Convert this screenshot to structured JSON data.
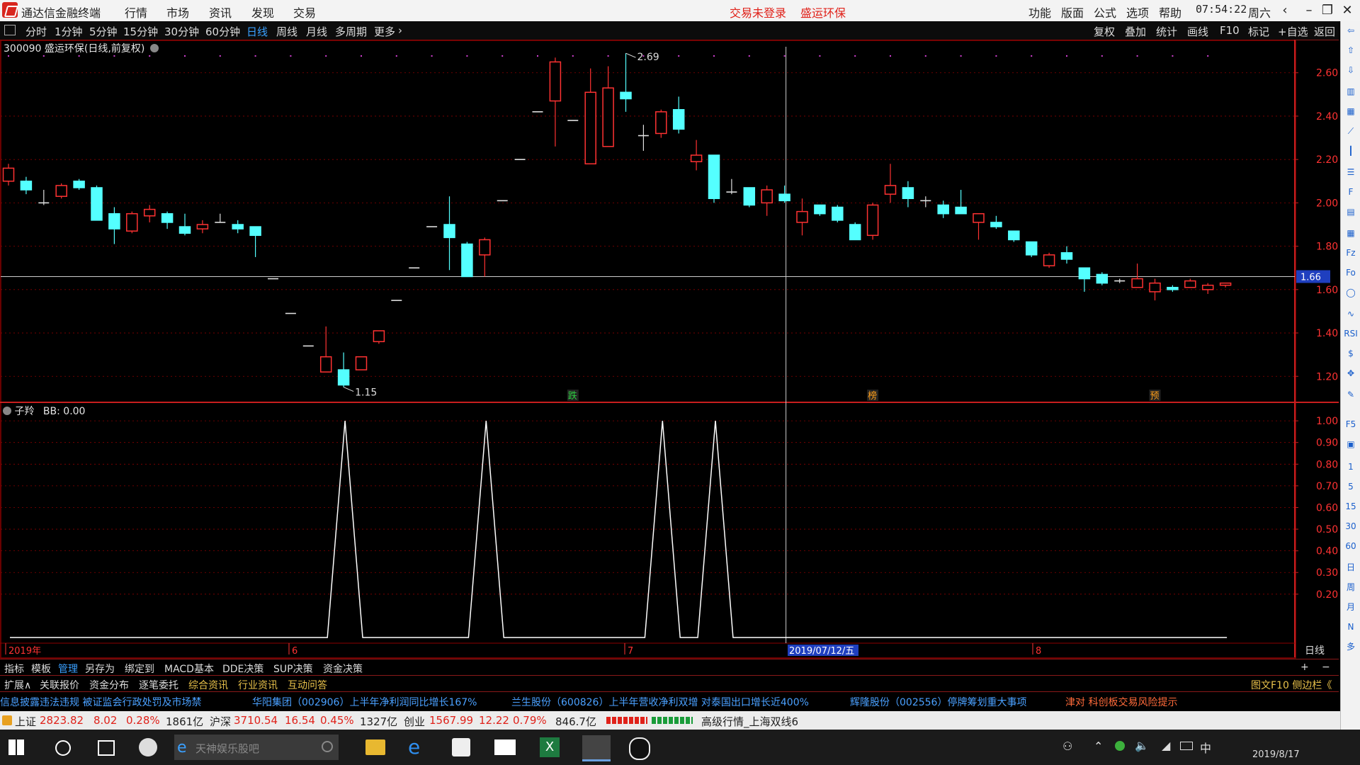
{
  "titlebar": {
    "app_name": "通达信金融终端",
    "menus": [
      "行情",
      "市场",
      "资讯",
      "发现",
      "交易"
    ],
    "login_status": "交易未登录",
    "stock_name": "盛运环保",
    "right_menus": [
      "功能",
      "版面",
      "公式",
      "选项",
      "帮助"
    ],
    "time": "07:54:22",
    "weekday": "周六"
  },
  "toolbar": {
    "periods": [
      "分时",
      "1分钟",
      "5分钟",
      "15分钟",
      "30分钟",
      "60分钟",
      "日线",
      "周线",
      "月线",
      "多周期",
      "更多"
    ],
    "active_period": "日线",
    "right_tools": [
      "复权",
      "叠加",
      "统计",
      "画线",
      "F10",
      "标记",
      "+自选",
      "返回"
    ]
  },
  "chart_header": {
    "code": "300090",
    "title": "盛运环保(日线,前复权)"
  },
  "sub_header": {
    "indicator": "子羚",
    "value_label": "BB: 0.00"
  },
  "chart_data": [
    {
      "type": "candlestick",
      "title": "300090 盛运环保(日线,前复权)",
      "yticks": [
        2.6,
        2.4,
        2.2,
        2.0,
        1.8,
        1.6,
        1.4,
        1.2
      ],
      "ylim": [
        1.08,
        2.72
      ],
      "price_tag": "1.66",
      "high_annotation": "2.69",
      "low_annotation": "1.15",
      "candles": [
        {
          "o": 2.1,
          "h": 2.18,
          "l": 2.08,
          "c": 2.16
        },
        {
          "o": 2.1,
          "h": 2.12,
          "l": 2.04,
          "c": 2.06
        },
        {
          "o": 2.0,
          "h": 2.06,
          "l": 1.99,
          "c": 2.0
        },
        {
          "o": 2.03,
          "h": 2.09,
          "l": 2.02,
          "c": 2.08
        },
        {
          "o": 2.1,
          "h": 2.11,
          "l": 2.06,
          "c": 2.07
        },
        {
          "o": 2.07,
          "h": 2.08,
          "l": 1.93,
          "c": 1.92
        },
        {
          "o": 1.95,
          "h": 1.98,
          "l": 1.81,
          "c": 1.88
        },
        {
          "o": 1.87,
          "h": 1.96,
          "l": 1.86,
          "c": 1.95
        },
        {
          "o": 1.94,
          "h": 1.99,
          "l": 1.91,
          "c": 1.97
        },
        {
          "o": 1.95,
          "h": 1.96,
          "l": 1.88,
          "c": 1.91
        },
        {
          "o": 1.89,
          "h": 1.95,
          "l": 1.85,
          "c": 1.86
        },
        {
          "o": 1.88,
          "h": 1.92,
          "l": 1.86,
          "c": 1.9
        },
        {
          "o": 1.91,
          "h": 1.95,
          "l": 1.91,
          "c": 1.91
        },
        {
          "o": 1.9,
          "h": 1.92,
          "l": 1.86,
          "c": 1.88
        },
        {
          "o": 1.89,
          "h": 1.89,
          "l": 1.75,
          "c": 1.85
        },
        {
          "o": 1.65,
          "h": 1.65,
          "l": 1.65,
          "c": 1.65
        },
        {
          "o": 1.49,
          "h": 1.49,
          "l": 1.49,
          "c": 1.49
        },
        {
          "o": 1.34,
          "h": 1.34,
          "l": 1.34,
          "c": 1.34
        },
        {
          "o": 1.22,
          "h": 1.43,
          "l": 1.22,
          "c": 1.29
        },
        {
          "o": 1.23,
          "h": 1.31,
          "l": 1.15,
          "c": 1.16
        },
        {
          "o": 1.23,
          "h": 1.29,
          "l": 1.23,
          "c": 1.29
        },
        {
          "o": 1.36,
          "h": 1.41,
          "l": 1.35,
          "c": 1.41
        },
        {
          "o": 1.55,
          "h": 1.55,
          "l": 1.55,
          "c": 1.55
        },
        {
          "o": 1.7,
          "h": 1.7,
          "l": 1.7,
          "c": 1.7
        },
        {
          "o": 1.89,
          "h": 1.89,
          "l": 1.89,
          "c": 1.89
        },
        {
          "o": 1.9,
          "h": 2.03,
          "l": 1.69,
          "c": 1.84
        },
        {
          "o": 1.81,
          "h": 1.82,
          "l": 1.66,
          "c": 1.66
        },
        {
          "o": 1.76,
          "h": 1.84,
          "l": 1.66,
          "c": 1.83
        },
        {
          "o": 2.01,
          "h": 2.01,
          "l": 2.01,
          "c": 2.01
        },
        {
          "o": 2.2,
          "h": 2.2,
          "l": 2.2,
          "c": 2.2
        },
        {
          "o": 2.42,
          "h": 2.42,
          "l": 2.42,
          "c": 2.42
        },
        {
          "o": 2.47,
          "h": 2.67,
          "l": 2.26,
          "c": 2.65
        },
        {
          "o": 2.38,
          "h": 2.38,
          "l": 2.38,
          "c": 2.38
        },
        {
          "o": 2.18,
          "h": 2.62,
          "l": 2.18,
          "c": 2.51
        },
        {
          "o": 2.26,
          "h": 2.63,
          "l": 2.26,
          "c": 2.53
        },
        {
          "o": 2.51,
          "h": 2.69,
          "l": 2.42,
          "c": 2.48
        },
        {
          "o": 2.31,
          "h": 2.36,
          "l": 2.24,
          "c": 2.31
        },
        {
          "o": 2.32,
          "h": 2.43,
          "l": 2.3,
          "c": 2.42
        },
        {
          "o": 2.43,
          "h": 2.49,
          "l": 2.32,
          "c": 2.34
        },
        {
          "o": 2.19,
          "h": 2.29,
          "l": 2.15,
          "c": 2.22
        },
        {
          "o": 2.22,
          "h": 2.22,
          "l": 2.0,
          "c": 2.02
        },
        {
          "o": 2.05,
          "h": 2.11,
          "l": 2.04,
          "c": 2.05
        },
        {
          "o": 2.07,
          "h": 2.07,
          "l": 1.98,
          "c": 1.99
        },
        {
          "o": 2.0,
          "h": 2.08,
          "l": 1.94,
          "c": 2.06
        },
        {
          "o": 2.04,
          "h": 2.08,
          "l": 2.0,
          "c": 2.01
        },
        {
          "o": 1.91,
          "h": 2.02,
          "l": 1.85,
          "c": 1.96
        },
        {
          "o": 1.99,
          "h": 1.99,
          "l": 1.94,
          "c": 1.95
        },
        {
          "o": 1.98,
          "h": 1.99,
          "l": 1.91,
          "c": 1.92
        },
        {
          "o": 1.9,
          "h": 1.91,
          "l": 1.83,
          "c": 1.83
        },
        {
          "o": 1.85,
          "h": 2.0,
          "l": 1.83,
          "c": 1.99
        },
        {
          "o": 2.04,
          "h": 2.18,
          "l": 2.0,
          "c": 2.08
        },
        {
          "o": 2.07,
          "h": 2.1,
          "l": 1.98,
          "c": 2.02
        },
        {
          "o": 2.01,
          "h": 2.03,
          "l": 1.98,
          "c": 2.01
        },
        {
          "o": 1.99,
          "h": 2.01,
          "l": 1.93,
          "c": 1.95
        },
        {
          "o": 1.98,
          "h": 2.06,
          "l": 1.96,
          "c": 1.95
        },
        {
          "o": 1.91,
          "h": 1.95,
          "l": 1.83,
          "c": 1.95
        },
        {
          "o": 1.91,
          "h": 1.94,
          "l": 1.88,
          "c": 1.89
        },
        {
          "o": 1.87,
          "h": 1.87,
          "l": 1.82,
          "c": 1.83
        },
        {
          "o": 1.82,
          "h": 1.82,
          "l": 1.75,
          "c": 1.76
        },
        {
          "o": 1.71,
          "h": 1.77,
          "l": 1.7,
          "c": 1.76
        },
        {
          "o": 1.77,
          "h": 1.8,
          "l": 1.72,
          "c": 1.74
        },
        {
          "o": 1.7,
          "h": 1.7,
          "l": 1.59,
          "c": 1.65
        },
        {
          "o": 1.67,
          "h": 1.68,
          "l": 1.62,
          "c": 1.63
        },
        {
          "o": 1.64,
          "h": 1.65,
          "l": 1.63,
          "c": 1.64
        },
        {
          "o": 1.61,
          "h": 1.72,
          "l": 1.61,
          "c": 1.65
        },
        {
          "o": 1.59,
          "h": 1.65,
          "l": 1.55,
          "c": 1.63
        },
        {
          "o": 1.61,
          "h": 1.62,
          "l": 1.59,
          "c": 1.6
        },
        {
          "o": 1.61,
          "h": 1.65,
          "l": 1.61,
          "c": 1.64
        },
        {
          "o": 1.6,
          "h": 1.63,
          "l": 1.58,
          "c": 1.62
        },
        {
          "o": 1.62,
          "h": 1.63,
          "l": 1.61,
          "c": 1.63
        }
      ],
      "signal_markers": [
        "跌",
        "榜",
        "预"
      ],
      "bottom_axis": [
        "2019年",
        "6",
        "7",
        "2019/07/12/五",
        "8"
      ],
      "period_label": "日线"
    },
    {
      "type": "line",
      "title": "子羚 BB: 0.00",
      "yticks": [
        1.0,
        0.9,
        0.8,
        0.7,
        0.6,
        0.5,
        0.4,
        0.3,
        0.2
      ],
      "ylim": [
        0,
        1.02
      ],
      "values": [
        0,
        0,
        0,
        0,
        0,
        0,
        0,
        0,
        0,
        0,
        0,
        0,
        0,
        0,
        0,
        0,
        0,
        0,
        0,
        1,
        0,
        0,
        0,
        0,
        0,
        0,
        0,
        1,
        0,
        0,
        0,
        0,
        0,
        0,
        0,
        0,
        0,
        1,
        0,
        0,
        1,
        0,
        0,
        0,
        0,
        0,
        0,
        0,
        0,
        0,
        0,
        0,
        0,
        0,
        0,
        0,
        0,
        0,
        0,
        0,
        0,
        0,
        0,
        0,
        0,
        0,
        0,
        0,
        0,
        0
      ]
    }
  ],
  "tabs_row1": [
    "指标",
    "模板",
    "管理",
    "另存为",
    "绑定到",
    "MACD基本",
    "DDE决策",
    "SUP决策",
    "资金决策"
  ],
  "tabs_row1_active": "管理",
  "tabs_row2": [
    "扩展∧",
    "关联报价",
    "资金分布",
    "逐笔委托",
    "综合资讯",
    "行业资讯",
    "互动问答"
  ],
  "tabs_row2_right": "图文F10 侧边栏《",
  "news": [
    "信息披露违法违规 被证监会行政处罚及市场禁",
    "华阳集团（002906）上半年净利润同比增长167%",
    "兰生股份（600826）上半年营收净利双增 对泰国出口增长近400%",
    "辉隆股份（002556）停牌筹划重大事项",
    "津对 科创板交易风险提示"
  ],
  "indices": [
    {
      "name": "上证",
      "value": "2823.82",
      "change": "8.02",
      "pct": "0.28%",
      "vol": "1861亿"
    },
    {
      "name": "沪深",
      "value": "3710.54",
      "change": "16.54",
      "pct": "0.45%",
      "vol": "1327亿"
    },
    {
      "name": "创业",
      "value": "1567.99",
      "change": "12.22",
      "pct": "0.79%",
      "vol": "846.7亿"
    }
  ],
  "feed_label": "高级行情_上海双线6",
  "taskbar": {
    "search_placeholder": "天神娱乐股吧",
    "tray_time": "2019/8/17",
    "ime": "中"
  },
  "colors": {
    "up": "#ff3232",
    "down": "#54ffff",
    "grid": "#8b0000",
    "accent": "#3aa0ff"
  }
}
